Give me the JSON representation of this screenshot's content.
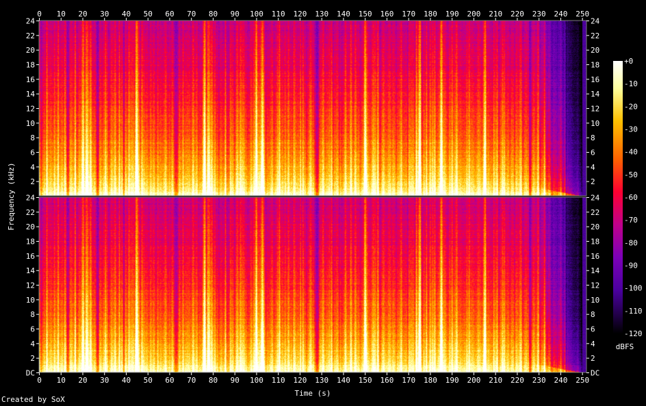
{
  "chart_data": {
    "type": "heatmap",
    "title": "",
    "xlabel": "Time (s)",
    "ylabel": "Frequency (kHz)",
    "x_ticks": [
      0,
      10,
      20,
      30,
      40,
      50,
      60,
      70,
      80,
      90,
      100,
      110,
      120,
      130,
      140,
      150,
      160,
      170,
      180,
      190,
      200,
      210,
      220,
      230,
      240,
      250
    ],
    "y_ticks": [
      "DC",
      "2",
      "4",
      "6",
      "8",
      "10",
      "12",
      "14",
      "16",
      "18",
      "20",
      "22",
      "24"
    ],
    "x_range": [
      0,
      252
    ],
    "y_range_khz": [
      0,
      24
    ],
    "channels": 2,
    "colorbar": {
      "label": "dBFS",
      "ticks": [
        "+0",
        "-10",
        "-20",
        "-30",
        "-40",
        "-50",
        "-60",
        "-70",
        "-80",
        "-90",
        "-100",
        "-110",
        "-120"
      ],
      "range": [
        -120,
        0
      ],
      "colors": [
        "#000000",
        "#22004a",
        "#4b00a0",
        "#7d00b8",
        "#c0008a",
        "#ff0030",
        "#ff6200",
        "#ffc000",
        "#ffff9e",
        "#ffffff"
      ]
    },
    "shape": {
      "fade_in_end_s": 2,
      "sound_end_s": 228,
      "tail_end_s": 250,
      "quiet_gaps_s": [
        13,
        27,
        63,
        128,
        138,
        226
      ],
      "loud_onsets_s": [
        20,
        22,
        45,
        76,
        78,
        100,
        103,
        150,
        175,
        185,
        205
      ]
    }
  },
  "footer": {
    "credit": "Created by SoX"
  }
}
